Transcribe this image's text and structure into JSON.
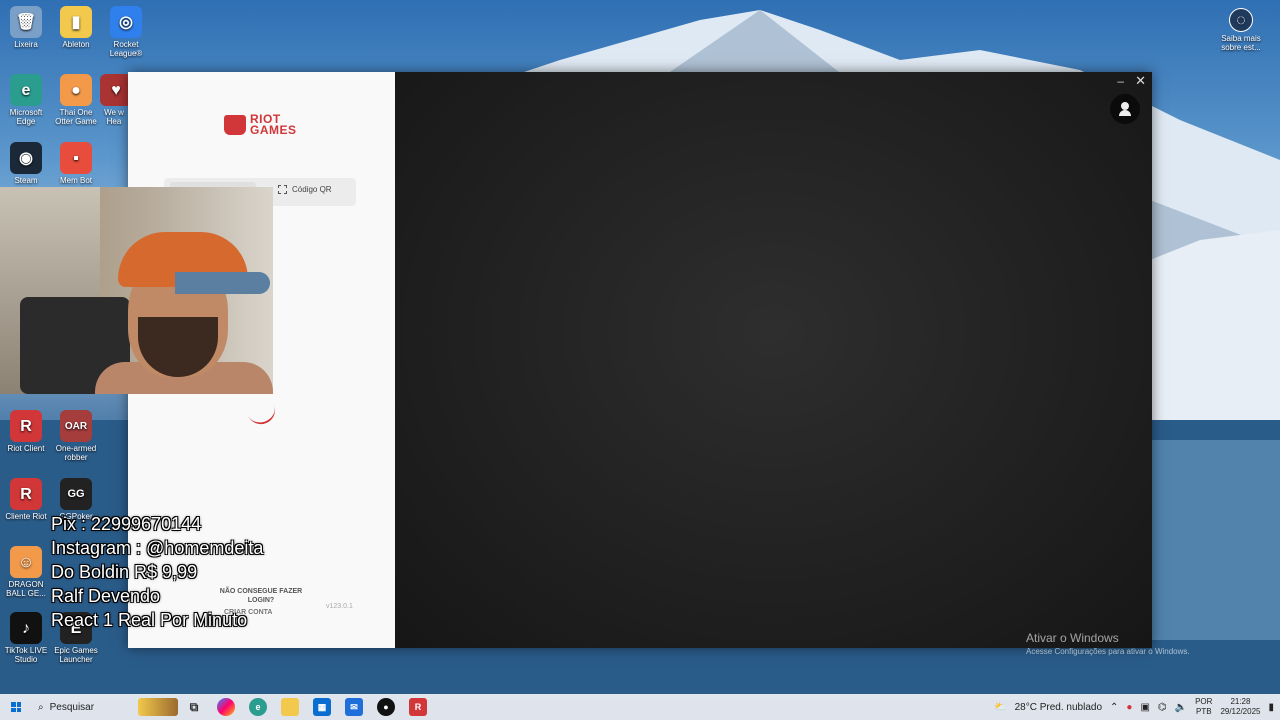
{
  "desktop": {
    "icons": [
      {
        "label": "Lixeira",
        "glyph": "🗑",
        "color": "#7aa0c8"
      },
      {
        "label": "Ableton",
        "glyph": "▮",
        "color": "#f2c94c"
      },
      {
        "label": "Rocket League®",
        "glyph": "◎",
        "color": "#2f80ed"
      },
      {
        "label": "Microsoft Edge",
        "glyph": "e",
        "color": "#2a9d8f"
      },
      {
        "label": "Thai One Otter Game",
        "glyph": "●",
        "color": "#f2994a"
      },
      {
        "label": "We w Hea",
        "glyph": "♥",
        "color": "#a33"
      },
      {
        "label": "Steam",
        "glyph": "◉",
        "color": "#1b2838"
      },
      {
        "label": "Mem Bot",
        "glyph": "▪",
        "color": "#e74c3c"
      },
      {
        "label": "Riot Client",
        "glyph": "R",
        "color": "#d13639"
      },
      {
        "label": "One-armed robber",
        "glyph": "OAR",
        "color": "#a63d3d"
      },
      {
        "label": "Cliente Riot",
        "glyph": "R",
        "color": "#d13639"
      },
      {
        "label": "GGPoker",
        "glyph": "GG",
        "color": "#222"
      },
      {
        "label": "DRAGON BALL GE...",
        "glyph": "☺",
        "color": "#f2994a"
      },
      {
        "label": "TikTok LIVE Studio",
        "glyph": "♪",
        "color": "#111"
      },
      {
        "label": "Epic Games Launcher",
        "glyph": "E",
        "color": "#222"
      },
      {
        "label": "Saiba mais sobre est...",
        "glyph": "◌",
        "color": "#1f3a5c"
      }
    ]
  },
  "riot": {
    "logo_line1": "RIOT",
    "logo_line2": "GAMES",
    "tab_qr": "Código QR",
    "cant_login": "NÃO CONSEGUE FAZER LOGIN?",
    "create_account": "CRIAR CONTA",
    "version": "v123.0.1",
    "window_minimize": "–",
    "window_close": "✕"
  },
  "overlay": {
    "lines": [
      "Pix : 22999670144",
      "Instagram : @homemdeita",
      "Do Boldin R$ 9,99",
      "Ralf Devendo",
      "React 1 Real Por Minuto"
    ]
  },
  "watermark": {
    "title": "Ativar o Windows",
    "subtitle": "Acesse Configurações para ativar o Windows."
  },
  "taskbar": {
    "search_placeholder": "Pesquisar",
    "weather": "28°C  Pred. nublado",
    "lang1": "POR",
    "lang2": "PTB",
    "time": "21:28",
    "date": "29/12/2025"
  }
}
